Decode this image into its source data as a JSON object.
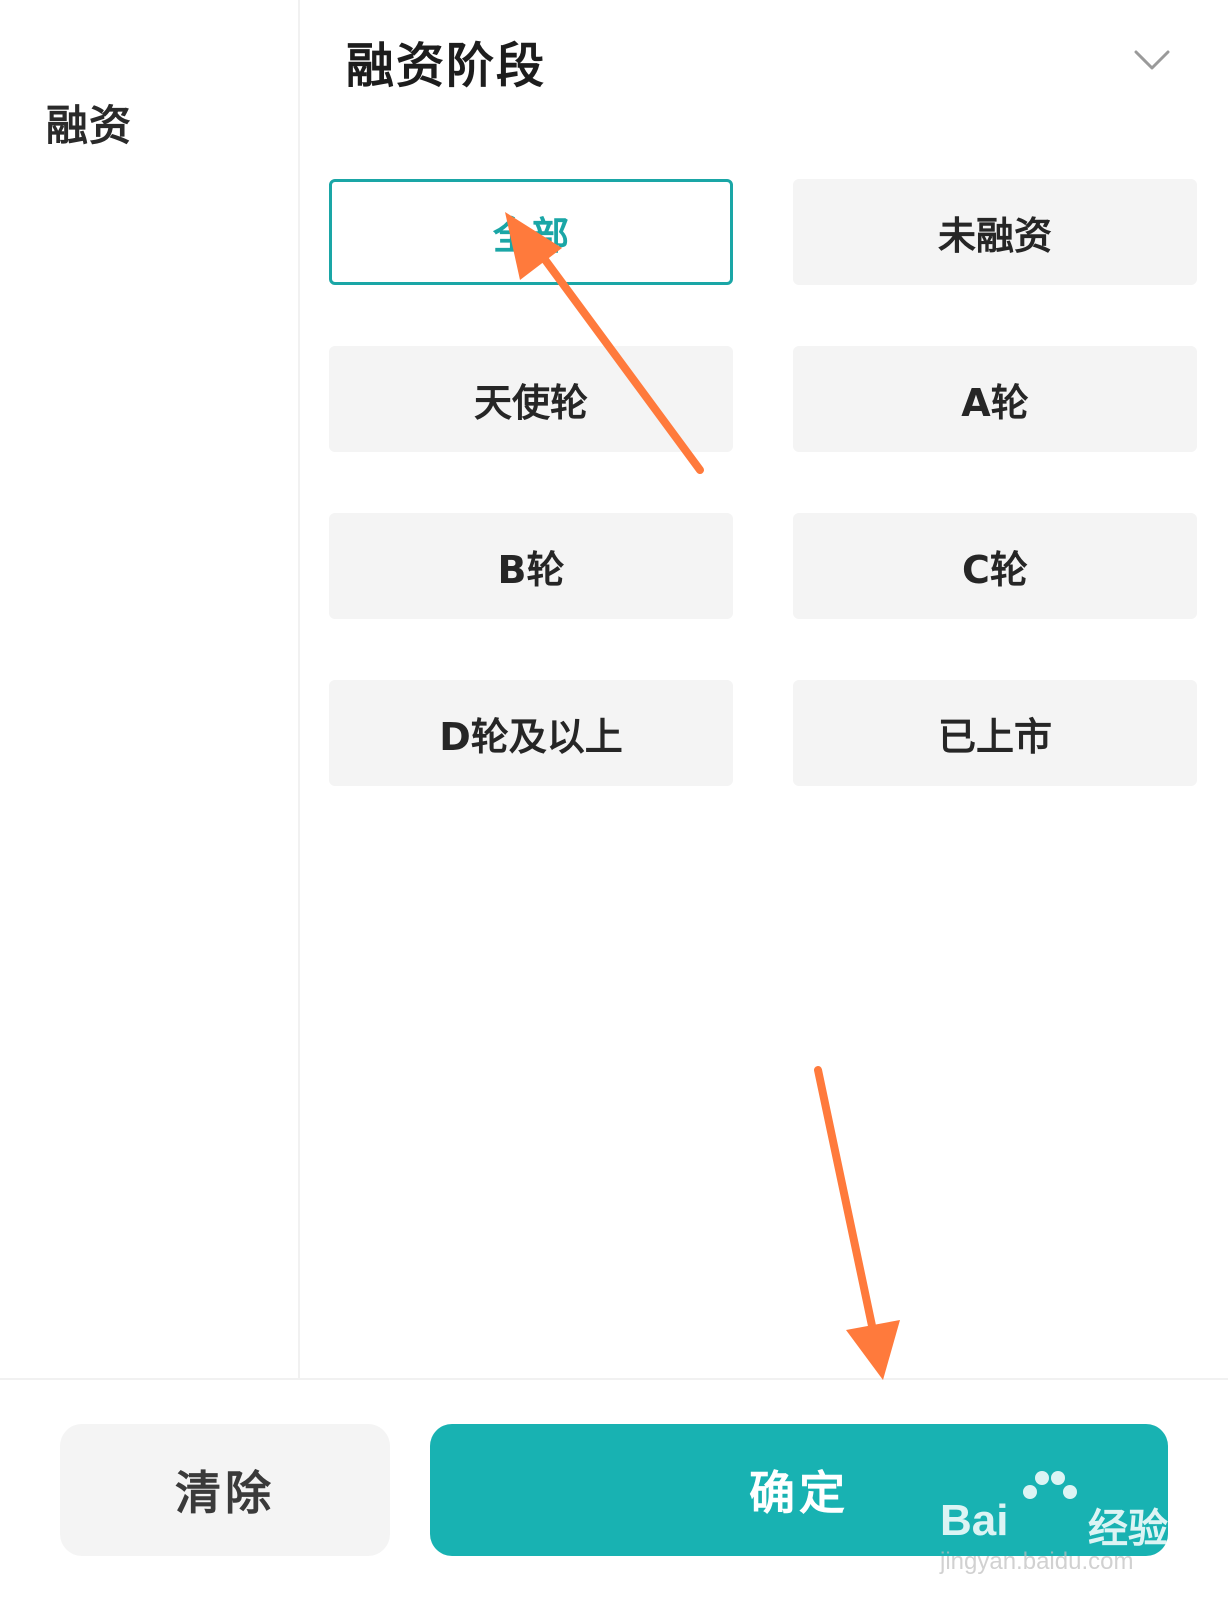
{
  "sidebar": {
    "items": [
      {
        "label": "融资"
      }
    ]
  },
  "main": {
    "section_title": "融资阶段",
    "collapse_icon": "chevron-down-icon",
    "options": [
      {
        "label": "全部",
        "selected": true
      },
      {
        "label": "未融资",
        "selected": false
      },
      {
        "label": "天使轮",
        "selected": false
      },
      {
        "label": "A轮",
        "selected": false
      },
      {
        "label": "B轮",
        "selected": false
      },
      {
        "label": "C轮",
        "selected": false
      },
      {
        "label": "D轮及以上",
        "selected": false
      },
      {
        "label": "已上市",
        "selected": false
      }
    ]
  },
  "footer": {
    "clear_label": "清除",
    "confirm_label": "确定"
  },
  "watermark": {
    "brand": "Bai",
    "brand_suffix": "经验",
    "url": "jingyan.baidu.com"
  },
  "colors": {
    "accent": "#18b2b2",
    "annotation_arrow": "#ff7a3c",
    "option_bg": "#f4f4f4"
  }
}
